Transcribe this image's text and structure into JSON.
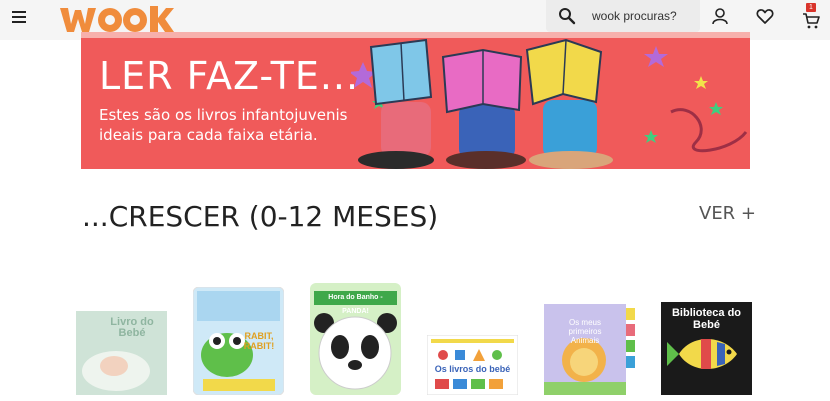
{
  "header": {
    "logo_text": "WOOK",
    "search_placeholder": "wook procuras?",
    "cart_count": "1",
    "icons": [
      "menu-icon",
      "search-icon",
      "user-icon",
      "heart-icon",
      "cart-icon"
    ]
  },
  "banner": {
    "title": "LER FAZ-TE...",
    "subtitle_line1": "Estes são os livros infantojuvenis",
    "subtitle_line2": "ideais para cada faixa etária.",
    "background_color": "#f05a5a"
  },
  "section": {
    "title": "...CRESCER (0-12 MESES)",
    "see_more_label": "VER +"
  },
  "books": [
    {
      "cover_text": "Livro do Bebé"
    },
    {
      "cover_text": "RABIT, RABIT!"
    },
    {
      "cover_text": "Hora do Banho - PANDA!"
    },
    {
      "cover_text": "Os livros do bebé"
    },
    {
      "cover_text": "Os meus primeiros Animais"
    },
    {
      "cover_text": "Biblioteca do Bebé"
    }
  ],
  "colors": {
    "brand_orange": "#f08c3c",
    "badge_red": "#d9342b"
  }
}
